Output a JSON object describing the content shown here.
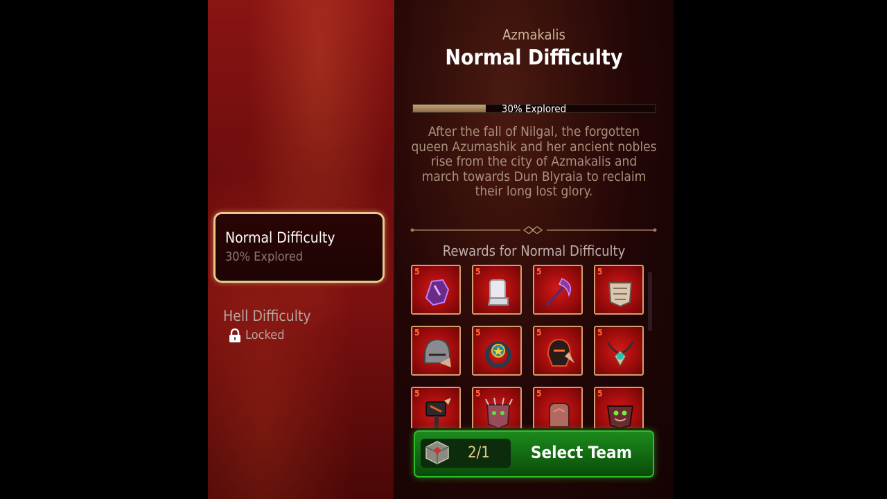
{
  "zone": {
    "name": "Azmakalis",
    "title": "Normal Difficulty"
  },
  "progress": {
    "label": "30% Explored",
    "percent": 30
  },
  "lore": "After the fall of Nilgal, the forgotten queen Azumashik and her ancient nobles rise from the city of Azmakalis and march towards Dun Blyraia to reclaim their long lost glory.",
  "difficulties": [
    {
      "title": "Normal Difficulty",
      "status": "30% Explored",
      "selected": true
    },
    {
      "title": "Hell Difficulty",
      "status": "Locked",
      "selected": false
    }
  ],
  "rewards": {
    "title": "Rewards for Normal Difficulty",
    "items": [
      {
        "level": "5",
        "icon": "purple-helmet-icon"
      },
      {
        "level": "5",
        "icon": "white-boots-icon"
      },
      {
        "level": "5",
        "icon": "purple-scythe-icon"
      },
      {
        "level": "5",
        "icon": "bone-armor-icon"
      },
      {
        "level": "5",
        "icon": "steel-helm-icon"
      },
      {
        "level": "5",
        "icon": "amulet-ring-icon"
      },
      {
        "level": "5",
        "icon": "dark-mask-icon"
      },
      {
        "level": "5",
        "icon": "teal-necklace-icon"
      },
      {
        "level": "5",
        "icon": "war-hammer-icon"
      },
      {
        "level": "5",
        "icon": "spiked-armor-icon"
      },
      {
        "level": "5",
        "icon": "leather-gloves-icon"
      },
      {
        "level": "5",
        "icon": "monster-chest-icon"
      }
    ]
  },
  "action": {
    "counter": "2/1",
    "label": "Select Team"
  },
  "colors": {
    "accent": "#e9c98a",
    "button": "#1c8a1c",
    "background": "#5a0909"
  }
}
